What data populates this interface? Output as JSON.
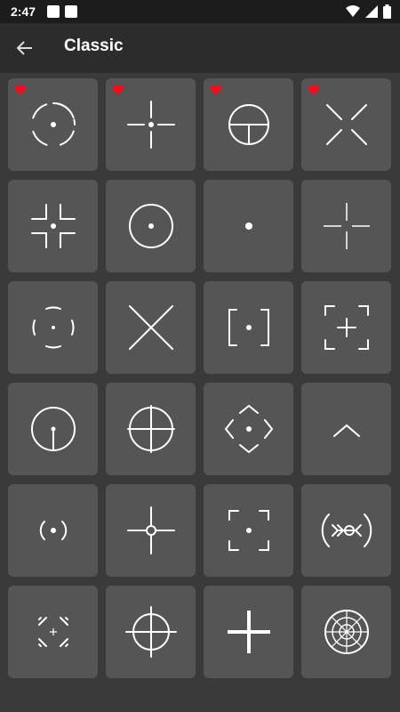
{
  "status_bar": {
    "time": "2:47"
  },
  "app_bar": {
    "title": "Classic"
  },
  "colors": {
    "favorite": "#e81123",
    "tile": "#555555",
    "icon": "#ffffff"
  },
  "crosshairs": [
    {
      "icon": "circle-gap-dot-crosshair-icon",
      "favorite": true
    },
    {
      "icon": "plus-gap-dot-crosshair-icon",
      "favorite": true
    },
    {
      "icon": "circle-t-crosshair-icon",
      "favorite": true
    },
    {
      "icon": "x-gap-crosshair-icon",
      "favorite": true
    },
    {
      "icon": "corner-brackets-dot-crosshair-icon",
      "favorite": false
    },
    {
      "icon": "circle-dot-crosshair-icon",
      "favorite": false
    },
    {
      "icon": "dot-crosshair-icon",
      "favorite": false
    },
    {
      "icon": "thin-plus-crosshair-icon",
      "favorite": false
    },
    {
      "icon": "arc-segments-dot-crosshair-icon",
      "favorite": false
    },
    {
      "icon": "x-crosshair-icon",
      "favorite": false
    },
    {
      "icon": "brackets-dot-crosshair-icon",
      "favorite": false
    },
    {
      "icon": "corner-frame-plus-crosshair-icon",
      "favorite": false
    },
    {
      "icon": "circle-post-crosshair-icon",
      "favorite": false
    },
    {
      "icon": "circle-plus-crosshair-icon",
      "favorite": false
    },
    {
      "icon": "diamond-chevrons-crosshair-icon",
      "favorite": false
    },
    {
      "icon": "chevron-crosshair-icon",
      "favorite": false
    },
    {
      "icon": "parentheses-dot-crosshair-icon",
      "favorite": false
    },
    {
      "icon": "plus-ring-crosshair-icon",
      "favorite": false
    },
    {
      "icon": "corner-frame-dot-crosshair-icon",
      "favorite": false
    },
    {
      "icon": "chevron-scope-crosshair-icon",
      "favorite": false
    },
    {
      "icon": "quad-arc-crosshair-icon",
      "favorite": false
    },
    {
      "icon": "circle-plus-extended-crosshair-icon",
      "favorite": false
    },
    {
      "icon": "thick-plus-crosshair-icon",
      "favorite": false
    },
    {
      "icon": "radar-crosshair-icon",
      "favorite": false
    }
  ]
}
